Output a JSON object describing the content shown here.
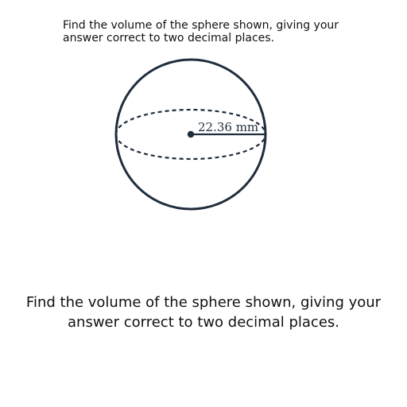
{
  "question": {
    "top_text": "Find the volume of the sphere shown, giving your answer correct to two decimal places.",
    "bottom_text": "Find the volume of the sphere shown, giving your answer correct to two decimal places."
  },
  "figure": {
    "shape": "sphere",
    "radius_label": "22.36 mm",
    "stroke_color": "#1f2d3d"
  }
}
